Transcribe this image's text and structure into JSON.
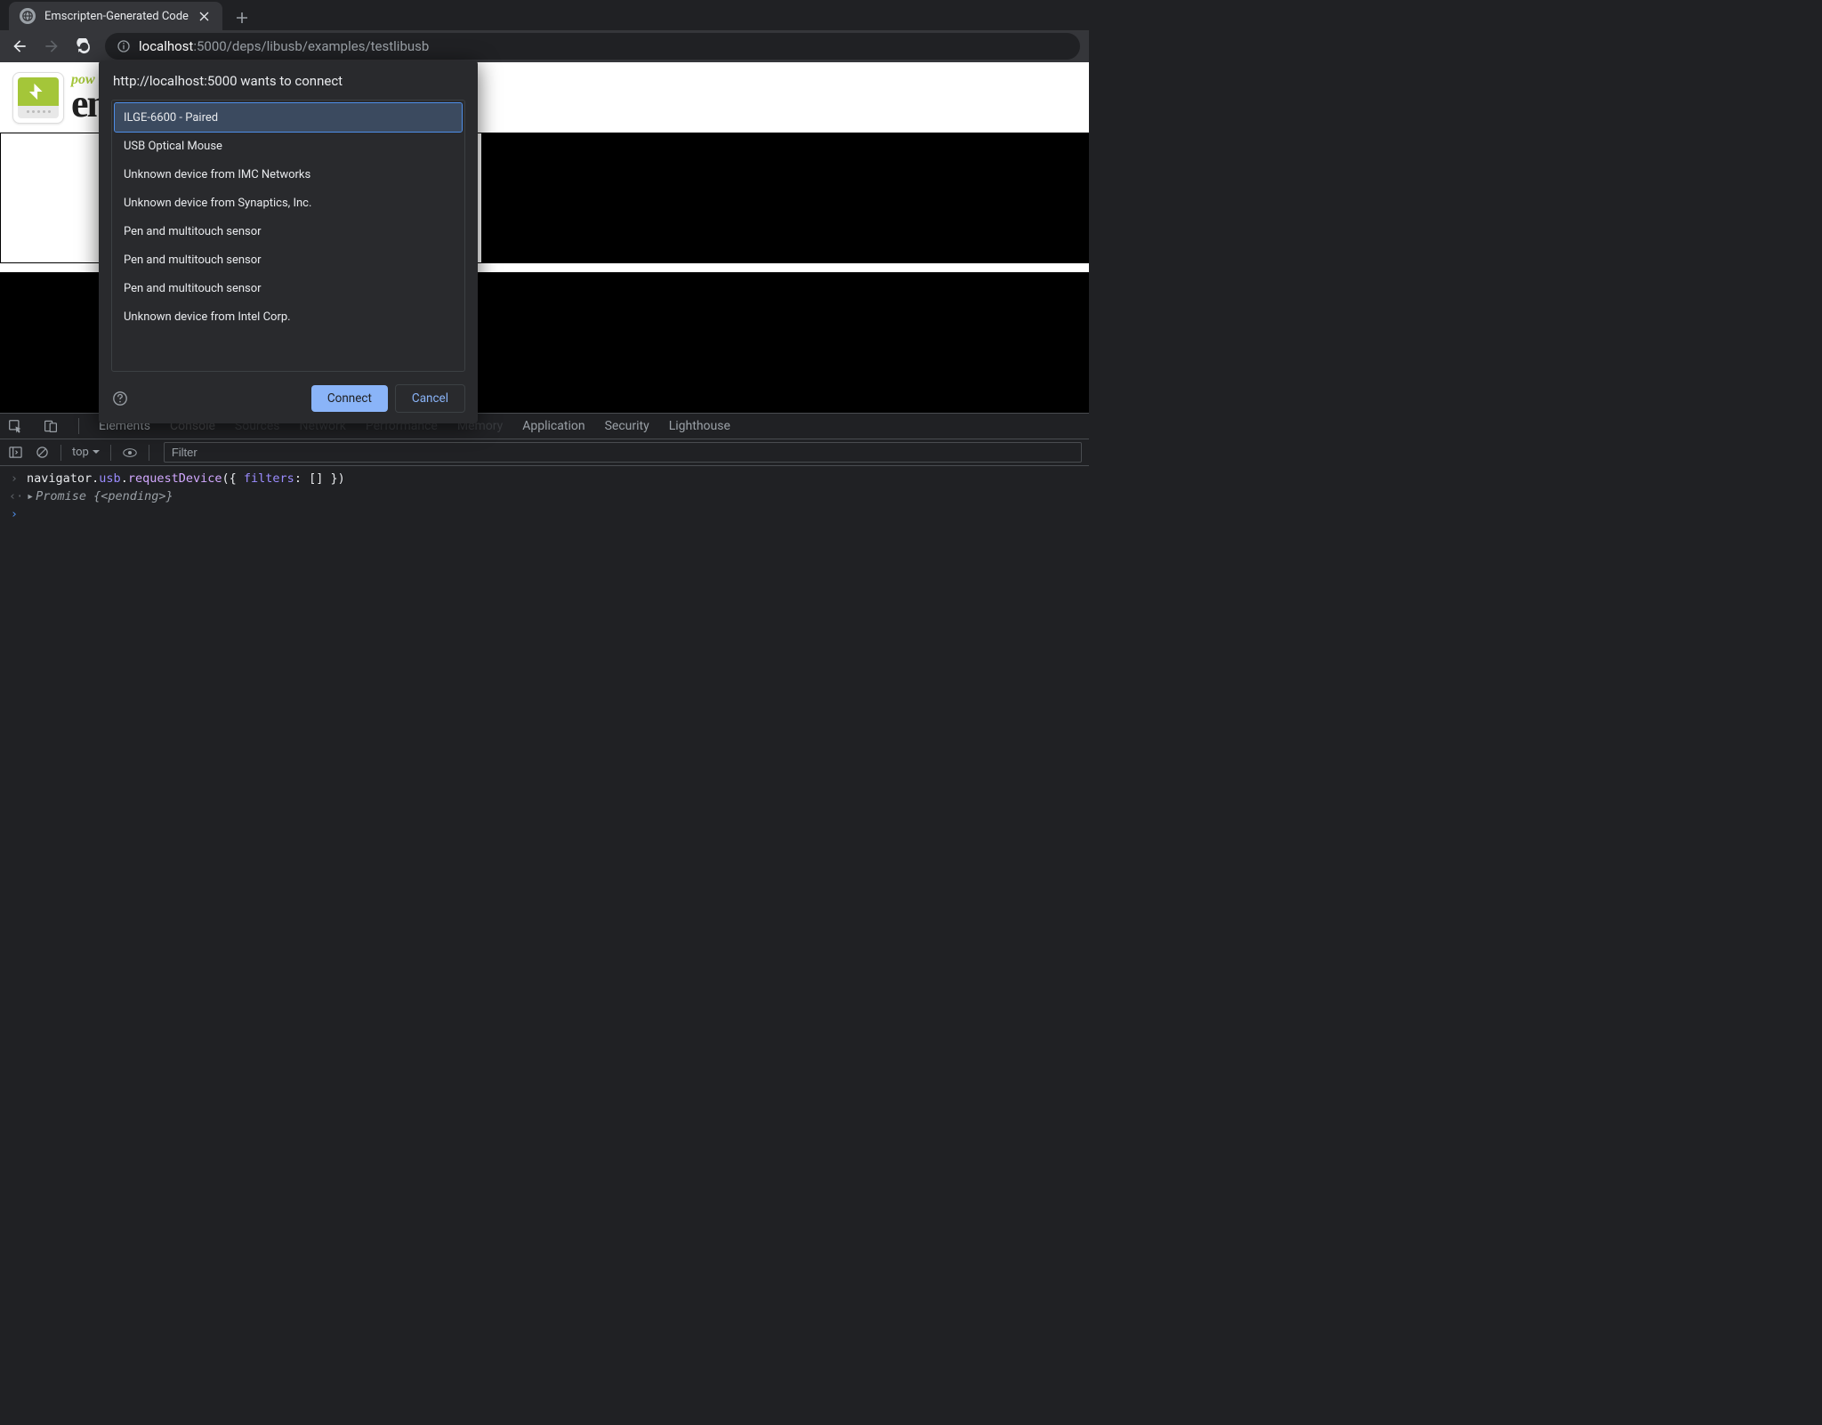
{
  "tab": {
    "title": "Emscripten-Generated Code"
  },
  "address": {
    "host": "localhost",
    "path": ":5000/deps/libusb/examples/testlibusb"
  },
  "page": {
    "pow": "pow",
    "en": "en"
  },
  "dialog": {
    "title": "http://localhost:5000 wants to connect",
    "devices": [
      "ILGE-6600 - Paired",
      "USB Optical Mouse",
      "Unknown device from IMC Networks",
      "Unknown device from Synaptics, Inc.",
      "Pen and multitouch sensor",
      "Pen and multitouch sensor",
      "Pen and multitouch sensor",
      "Unknown device from Intel Corp."
    ],
    "connect": "Connect",
    "cancel": "Cancel"
  },
  "devtools": {
    "tabs": {
      "elements": "Elements",
      "console": "Console",
      "sources": "Sources",
      "network": "Network",
      "performance": "Performance",
      "memory": "Memory",
      "application": "Application",
      "security": "Security",
      "lighthouse": "Lighthouse"
    },
    "context": "top",
    "filter_placeholder": "Filter",
    "lines": {
      "input": "navigator.usb.requestDevice({ filters: [] })",
      "output_prefix": "Promise ",
      "output_value": "{<pending>}"
    }
  }
}
